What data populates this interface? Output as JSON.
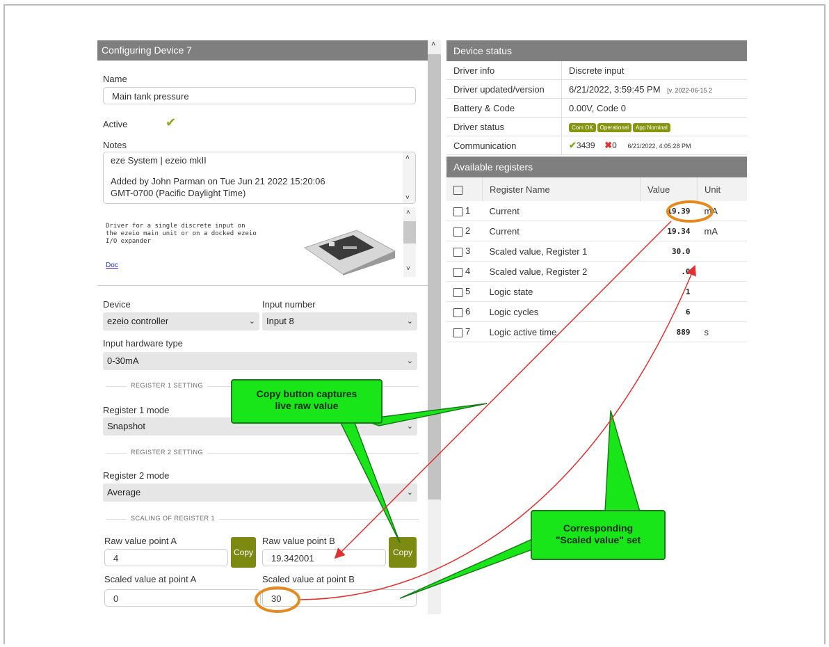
{
  "left": {
    "title": "Configuring Device 7",
    "name_label": "Name",
    "name_value": "Main tank pressure",
    "active_label": "Active",
    "notes_label": "Notes",
    "notes_line1": "eze System | ezeio mkII",
    "notes_line2": "Added by John Parman on Tue Jun 21 2022 15:20:06",
    "notes_line3": "GMT-0700 (Pacific Daylight Time)",
    "driver_desc": "Driver for a single discrete input on\nthe ezeio main unit or on a docked ezeio\nI/O expander",
    "doc_link": "Doc",
    "device_label": "Device",
    "device_value": "ezeio controller",
    "input_number_label": "Input number",
    "input_number_value": "Input 8",
    "hw_type_label": "Input hardware type",
    "hw_type_value": "0-30mA",
    "reg1_setting": "REGISTER 1 SETTING",
    "reg1_mode_label": "Register 1 mode",
    "reg1_mode_value": "Snapshot",
    "reg2_setting": "REGISTER 2 SETTING",
    "reg2_mode_label": "Register 2 mode",
    "reg2_mode_value": "Average",
    "scaling_label": "SCALING OF REGISTER 1",
    "raw_a_label": "Raw value point A",
    "raw_a_value": "4",
    "raw_b_label": "Raw value point B",
    "raw_b_value": "19.342001",
    "copy_label": "Copy",
    "scaled_a_label": "Scaled value at point A",
    "scaled_a_value": "0",
    "scaled_b_label": "Scaled value at point B",
    "scaled_b_value": "30"
  },
  "status": {
    "title": "Device status",
    "rows": [
      {
        "k": "Driver info",
        "v": "Discrete input"
      },
      {
        "k": "Driver updated/version",
        "v": "6/21/2022, 3:59:45 PM",
        "extra": "[v. 2022-06-15 2"
      },
      {
        "k": "Battery & Code",
        "v": "0.00V, Code 0"
      },
      {
        "k": "Driver status",
        "badges": [
          "Com OK",
          "Operational",
          "App Nominal"
        ]
      },
      {
        "k": "Communication",
        "ok": "3439",
        "err": "0",
        "ts": "6/21/2022, 4:05:28 PM"
      }
    ]
  },
  "registers": {
    "title": "Available registers",
    "headers": [
      "Register Name",
      "Value",
      "Unit"
    ],
    "rows": [
      {
        "n": "1",
        "name": "Current",
        "value": "19.39",
        "unit": "mA"
      },
      {
        "n": "2",
        "name": "Current",
        "value": "19.34",
        "unit": "mA"
      },
      {
        "n": "3",
        "name": "Scaled value, Register 1",
        "value": "30.0",
        "unit": ""
      },
      {
        "n": "4",
        "name": "Scaled value, Register 2",
        "value": ".0",
        "unit": ""
      },
      {
        "n": "5",
        "name": "Logic state",
        "value": "1",
        "unit": ""
      },
      {
        "n": "6",
        "name": "Logic cycles",
        "value": "6",
        "unit": ""
      },
      {
        "n": "7",
        "name": "Logic active time",
        "value": "889",
        "unit": "s"
      }
    ]
  },
  "callouts": {
    "copy_line1": "Copy button captures",
    "copy_line2": "live raw value",
    "scaled_line1": "Corresponding",
    "scaled_line2": "\"Scaled value\" set"
  },
  "colors": {
    "header_gray": "#7f7f7f",
    "olive_button": "#7d8a12",
    "callout_green": "#19e619",
    "highlight_orange": "#e58a1f",
    "arrow_red": "#e03030"
  }
}
